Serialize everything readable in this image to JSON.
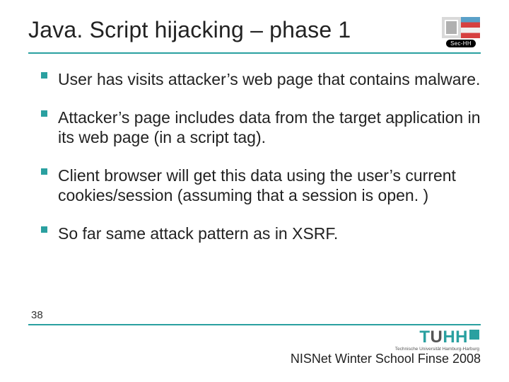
{
  "title": "Java. Script hijacking – phase 1",
  "corner_badge": "Sec-HH",
  "bullets": [
    "User has visits attacker’s web page that contains malware.",
    "Attacker’s page includes data from the target application in its web page (in a script tag).",
    "Client browser will get this data using the user’s current cookies/session (assuming that a session is open. )",
    "So far same attack pattern as in XSRF."
  ],
  "slide_number": "38",
  "tuhh": {
    "t": "T",
    "u": "U",
    "hh": "HH",
    "sub": "Technische Universität Hamburg-Harburg"
  },
  "footer_caption": "NISNet Winter School Finse 2008"
}
